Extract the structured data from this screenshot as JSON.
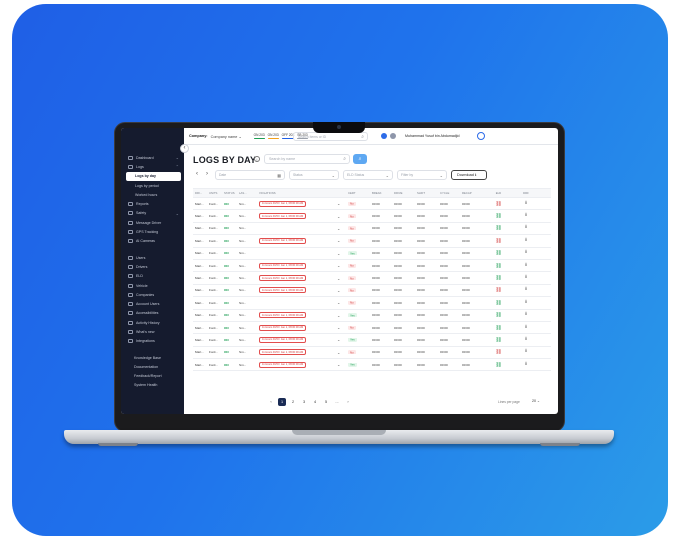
{
  "topbar": {
    "company_label": "Company:",
    "company_value": "Company name",
    "legend": [
      {
        "label": "ON 203",
        "color": "#1e9e55"
      },
      {
        "label": "ON 203",
        "color": "#f2a01c"
      },
      {
        "label": "OFF 203",
        "color": "#1f5fe6"
      },
      {
        "label": "SB 203",
        "color": "#9aa0aa"
      }
    ],
    "search_placeholder": "Search items or ID",
    "user_name": "Muhammad Yusuf bin Abdumadjid"
  },
  "sidebar": {
    "collapse_glyph": "‹",
    "items": [
      {
        "label": "Dashboard",
        "icon": "dashboard-icon",
        "chev": "⌄"
      },
      {
        "label": "Logs",
        "icon": "logs-icon",
        "chev": "⌃"
      },
      {
        "label": "Logs by day",
        "sub": true,
        "active": true
      },
      {
        "label": "Logs by period",
        "sub": true
      },
      {
        "label": "Worked hours",
        "sub": true
      },
      {
        "label": "Reports",
        "icon": "reports-icon"
      },
      {
        "label": "Safety",
        "icon": "safety-icon",
        "chev": "⌄"
      },
      {
        "label": "Message Driver",
        "icon": "message-icon"
      },
      {
        "label": "GPS Tracking",
        "icon": "gps-icon"
      },
      {
        "label": "AI Cameras",
        "icon": "camera-icon"
      },
      {
        "label": "",
        "spacer": true
      },
      {
        "label": "Users",
        "icon": "users-icon"
      },
      {
        "label": "Drivers",
        "icon": "drivers-icon"
      },
      {
        "label": "ELD",
        "icon": "eld-icon"
      },
      {
        "label": "Vehicle",
        "icon": "vehicle-icon"
      },
      {
        "label": "Companies",
        "icon": "companies-icon"
      },
      {
        "label": "Account Users",
        "icon": "account-icon"
      },
      {
        "label": "Accessibilities",
        "icon": "access-icon"
      },
      {
        "label": "Activity History",
        "icon": "history-icon"
      },
      {
        "label": "What's new",
        "icon": "whatsnew-icon"
      },
      {
        "label": "Integrations",
        "icon": "integrations-icon"
      },
      {
        "label": "",
        "spacer": true
      },
      {
        "label": "Knowledge Base",
        "plain": true
      },
      {
        "label": "Documentation",
        "plain": true
      },
      {
        "label": "Feedback/Report",
        "plain": true
      },
      {
        "label": "System Health",
        "plain": true
      }
    ]
  },
  "header": {
    "title": "LOGS BY DAY",
    "search_placeholder": "Search by name"
  },
  "filters": {
    "prev": "‹",
    "next": "›",
    "date_placeholder": "Date",
    "status_placeholder": "Status",
    "eld_status_placeholder": "ELD Status",
    "filter_by_placeholder": "Filter by",
    "download_label": "Download"
  },
  "table": {
    "columns": [
      "DRI...",
      "UNITS",
      "STATUS",
      "LAS...",
      "VIOLATIONS",
      "",
      "CERT",
      "BREAK",
      "DRIVE",
      "SHIFT",
      "CYCLE",
      "RECAP",
      "ELD",
      "DRF"
    ],
    "rows": [
      {
        "driver": "Mart...",
        "unit": "Ford...",
        "status": "ON",
        "last": "Sm...",
        "violation": "11 Hours DVIO: Jan 1, 08:00:00 AM",
        "cert": "No",
        "times": [
          "00:00",
          "00:00",
          "00:00",
          "00:00",
          "00:00"
        ],
        "eld": "red"
      },
      {
        "driver": "Mart...",
        "unit": "Ford...",
        "status": "ON",
        "last": "Sm...",
        "violation": "11 Hours DVIO: Jan 1, 08:00:00 AM",
        "cert": "No",
        "times": [
          "00:00",
          "00:00",
          "00:00",
          "00:00",
          "00:00"
        ],
        "eld": "green"
      },
      {
        "driver": "Mart...",
        "unit": "Ford...",
        "status": "ON",
        "last": "Sm...",
        "violation": "",
        "cert": "No",
        "times": [
          "00:00",
          "00:00",
          "00:00",
          "00:00",
          "00:00"
        ],
        "eld": "green"
      },
      {
        "driver": "Mart...",
        "unit": "Ford...",
        "status": "ON",
        "last": "Sm...",
        "violation": "11 Hours DVIO: Jan 1, 08:00:00 AM",
        "cert": "No",
        "times": [
          "00:00",
          "00:00",
          "00:00",
          "00:00",
          "00:00"
        ],
        "eld": "red"
      },
      {
        "driver": "Mart...",
        "unit": "Ford...",
        "status": "ON",
        "last": "Sm...",
        "violation": "",
        "cert": "Yes",
        "times": [
          "00:00",
          "00:00",
          "00:00",
          "00:00",
          "00:00"
        ],
        "eld": "green"
      },
      {
        "driver": "Mart...",
        "unit": "Ford...",
        "status": "ON",
        "last": "Sm...",
        "violation": "11 Hours DVIO: Jan 1, 08:00:00 AM",
        "cert": "No",
        "times": [
          "00:00",
          "00:00",
          "00:00",
          "00:00",
          "00:00"
        ],
        "eld": "green"
      },
      {
        "driver": "Mart...",
        "unit": "Ford...",
        "status": "ON",
        "last": "Sm...",
        "violation": "11 Hours DVIO: Jan 1, 08:00:00 AM",
        "cert": "No",
        "times": [
          "00:00",
          "00:00",
          "00:00",
          "00:00",
          "00:00"
        ],
        "eld": "green"
      },
      {
        "driver": "Mart...",
        "unit": "Ford...",
        "status": "ON",
        "last": "Sm...",
        "violation": "11 Hours DVIO: Jan 1, 08:00:00 AM",
        "cert": "No",
        "times": [
          "00:00",
          "00:00",
          "00:00",
          "00:00",
          "00:00"
        ],
        "eld": "red"
      },
      {
        "driver": "Mart...",
        "unit": "Ford...",
        "status": "ON",
        "last": "Sm...",
        "violation": "",
        "cert": "No",
        "times": [
          "00:00",
          "00:00",
          "00:00",
          "00:00",
          "00:00"
        ],
        "eld": "green"
      },
      {
        "driver": "Mart...",
        "unit": "Ford...",
        "status": "ON",
        "last": "Sm...",
        "violation": "11 Hours DVIO: Jan 1, 08:00:00 AM",
        "cert": "Yes",
        "times": [
          "00:00",
          "00:00",
          "00:00",
          "00:00",
          "00:00"
        ],
        "eld": "green"
      },
      {
        "driver": "Mart...",
        "unit": "Ford...",
        "status": "ON",
        "last": "Sm...",
        "violation": "11 Hours DVIO: Jan 1, 08:00:00 AM",
        "cert": "No",
        "times": [
          "00:00",
          "00:00",
          "00:00",
          "00:00",
          "00:00"
        ],
        "eld": "green"
      },
      {
        "driver": "Mart...",
        "unit": "Ford...",
        "status": "ON",
        "last": "Sm...",
        "violation": "11 Hours DVIO: Jan 1, 08:00:00 AM",
        "cert": "Yes",
        "times": [
          "00:00",
          "00:00",
          "00:00",
          "00:00",
          "00:00"
        ],
        "eld": "green"
      },
      {
        "driver": "Mart...",
        "unit": "Ford...",
        "status": "ON",
        "last": "Sm...",
        "violation": "11 Hours DVIO: Jan 1, 08:00:00 AM",
        "cert": "No",
        "times": [
          "00:00",
          "00:00",
          "00:00",
          "00:00",
          "00:00"
        ],
        "eld": "red"
      },
      {
        "driver": "Mart...",
        "unit": "Ford...",
        "status": "ON",
        "last": "Sm...",
        "violation": "11 Hours DVIO: Jan 1, 08:00:00 AM",
        "cert": "Yes",
        "times": [
          "00:00",
          "00:00",
          "00:00",
          "00:00",
          "00:00"
        ],
        "eld": "green"
      }
    ]
  },
  "pagination": {
    "prev": "‹",
    "pages": [
      "1",
      "2",
      "3",
      "4",
      "5",
      "..."
    ],
    "next": "›",
    "lines_label": "Lines per page",
    "lines_value": "20"
  },
  "colors": {
    "background_gradient_start": "#1f5fe6",
    "background_gradient_end": "#2b9ce8",
    "sidebar": "#151b2e",
    "accent": "#5ea8f2",
    "danger": "#d13a3a",
    "success": "#1e9e55"
  }
}
